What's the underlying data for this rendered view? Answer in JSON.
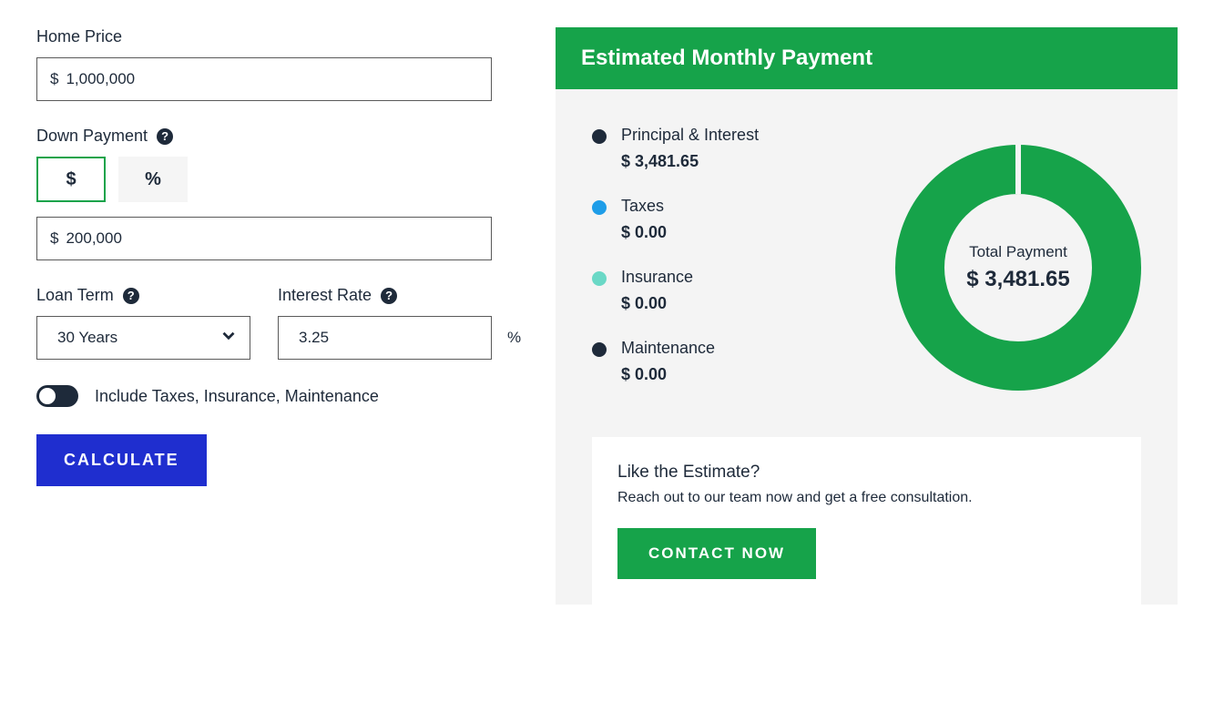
{
  "form": {
    "homePrice": {
      "label": "Home Price",
      "prefix": "$",
      "value": "1,000,000"
    },
    "downPayment": {
      "label": "Down Payment",
      "tabs": {
        "dollar": "$",
        "percent": "%",
        "active": "dollar"
      },
      "prefix": "$",
      "value": "200,000"
    },
    "loanTerm": {
      "label": "Loan Term",
      "value": "30 Years"
    },
    "interestRate": {
      "label": "Interest Rate",
      "value": "3.25",
      "suffix": "%"
    },
    "includeToggle": {
      "label": "Include Taxes, Insurance, Maintenance",
      "on": false
    },
    "calculate": "CALCULATE"
  },
  "result": {
    "title": "Estimated Monthly Payment",
    "items": [
      {
        "label": "Principal & Interest",
        "value": "$ 3,481.65",
        "color": "#1e2a3a"
      },
      {
        "label": "Taxes",
        "value": "$ 0.00",
        "color": "#1e9de8"
      },
      {
        "label": "Insurance",
        "value": "$ 0.00",
        "color": "#6ad8c6"
      },
      {
        "label": "Maintenance",
        "value": "$ 0.00",
        "color": "#1e2a3a"
      }
    ],
    "totalLabel": "Total Payment",
    "totalValue": "$ 3,481.65"
  },
  "cta": {
    "title": "Like the Estimate?",
    "sub": "Reach out to our team now and get a free consultation.",
    "button": "CONTACT NOW"
  },
  "chart_data": {
    "type": "pie",
    "title": "Estimated Monthly Payment",
    "categories": [
      "Principal & Interest",
      "Taxes",
      "Insurance",
      "Maintenance"
    ],
    "values": [
      3481.65,
      0.0,
      0.0,
      0.0
    ],
    "colors": [
      "#16a34a",
      "#1e9de8",
      "#6ad8c6",
      "#1e2a3a"
    ],
    "total": 3481.65,
    "donut": true
  }
}
